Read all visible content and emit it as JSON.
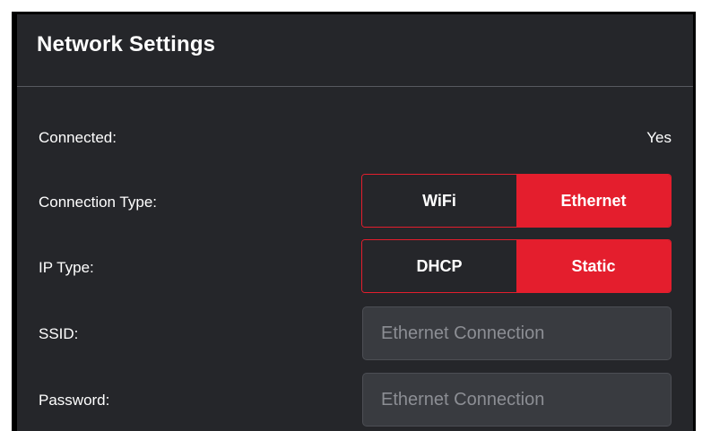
{
  "panel": {
    "title": "Network Settings"
  },
  "connected": {
    "label": "Connected:",
    "value": "Yes"
  },
  "connection_type": {
    "label": "Connection Type:",
    "options": [
      "WiFi",
      "Ethernet"
    ],
    "selected": "Ethernet"
  },
  "ip_type": {
    "label": "IP Type:",
    "options": [
      "DHCP",
      "Static"
    ],
    "selected": "Static"
  },
  "ssid": {
    "label": "SSID:",
    "placeholder": "Ethernet Connection",
    "value": ""
  },
  "password": {
    "label": "Password:",
    "placeholder": "Ethernet Connection",
    "value": ""
  },
  "colors": {
    "panel_bg": "#25262a",
    "accent": "#e41e2d",
    "input_bg": "#393b40",
    "placeholder_text": "#8c8e94",
    "text": "#ffffff"
  }
}
